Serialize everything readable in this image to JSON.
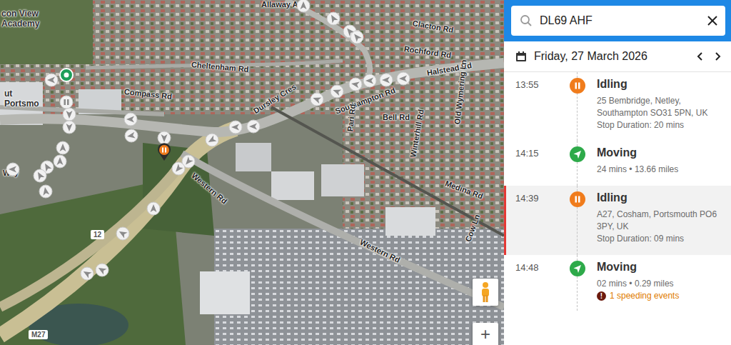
{
  "search": {
    "value": "DL69 AHF"
  },
  "date": {
    "label": "Friday, 27 March 2026"
  },
  "timeline": [
    {
      "time": "13:55",
      "kind": "idling",
      "title": "Idling",
      "address": "25 Bembridge, Netley, Southampton SO31 5PN, UK",
      "duration": "Stop Duration: 20 mins",
      "selected": false
    },
    {
      "time": "14:15",
      "kind": "moving",
      "title": "Moving",
      "summary": "24 mins • 13.66 miles",
      "selected": false
    },
    {
      "time": "14:39",
      "kind": "idling",
      "title": "Idling",
      "address": "A27, Cosham, Portsmouth PO6 3PY, UK",
      "duration": "Stop Duration: 09 mins",
      "selected": true
    },
    {
      "time": "14:48",
      "kind": "moving",
      "title": "Moving",
      "summary": "02 mins • 0.29 miles",
      "alert_icon": "!",
      "alert": "1 speeding events",
      "selected": false
    }
  ],
  "map": {
    "labels": [
      {
        "text": "Allaway A",
        "kind": "road"
      },
      {
        "text": "Clacton Rd",
        "kind": "road"
      },
      {
        "text": "Rochford Rd",
        "kind": "road"
      },
      {
        "text": "Cheltenham Rd",
        "kind": "road"
      },
      {
        "text": "Compass Rd",
        "kind": "road"
      },
      {
        "text": "Dursley Cres",
        "kind": "road"
      },
      {
        "text": "Southampton Rd",
        "kind": "road"
      },
      {
        "text": "Halstead Rd",
        "kind": "road"
      },
      {
        "text": "Bell Rd",
        "kind": "road"
      },
      {
        "text": "Pari Rd",
        "kind": "road"
      },
      {
        "text": "Winterhill Rd",
        "kind": "road"
      },
      {
        "text": "Old Wymering Ln",
        "kind": "road"
      },
      {
        "text": "Medina Rd",
        "kind": "road"
      },
      {
        "text": "Cow Ln",
        "kind": "road"
      },
      {
        "text": "Western Rd",
        "kind": "road"
      },
      {
        "text": "Western Rd",
        "kind": "road"
      },
      {
        "text": "Way",
        "kind": "road"
      },
      {
        "text": "con View Academy",
        "kind": "place"
      },
      {
        "text": "ut Portsmo",
        "kind": "place"
      },
      {
        "text": "M27",
        "kind": "shield"
      },
      {
        "text": "12",
        "kind": "shield"
      }
    ],
    "markers": [
      {
        "kind": "arrow"
      },
      {
        "kind": "arrow"
      },
      {
        "kind": "arrow"
      },
      {
        "kind": "arrow"
      },
      {
        "kind": "arrow"
      },
      {
        "kind": "arrow"
      },
      {
        "kind": "arrow"
      },
      {
        "kind": "arrow"
      },
      {
        "kind": "arrow"
      },
      {
        "kind": "arrow"
      },
      {
        "kind": "arrow"
      },
      {
        "kind": "arrow"
      },
      {
        "kind": "arrow"
      },
      {
        "kind": "arrow"
      },
      {
        "kind": "arrow"
      },
      {
        "kind": "arrow"
      },
      {
        "kind": "arrow"
      },
      {
        "kind": "arrow"
      },
      {
        "kind": "arrow"
      },
      {
        "kind": "arrow"
      },
      {
        "kind": "arrow"
      },
      {
        "kind": "arrow"
      },
      {
        "kind": "arrow"
      },
      {
        "kind": "arrow"
      },
      {
        "kind": "arrow"
      },
      {
        "kind": "arrow"
      },
      {
        "kind": "arrow"
      },
      {
        "kind": "arrow"
      },
      {
        "kind": "arrow"
      },
      {
        "kind": "arrow"
      },
      {
        "kind": "arrow"
      },
      {
        "kind": "stop"
      },
      {
        "kind": "start"
      },
      {
        "kind": "idle"
      }
    ],
    "zoom_in": "+"
  }
}
